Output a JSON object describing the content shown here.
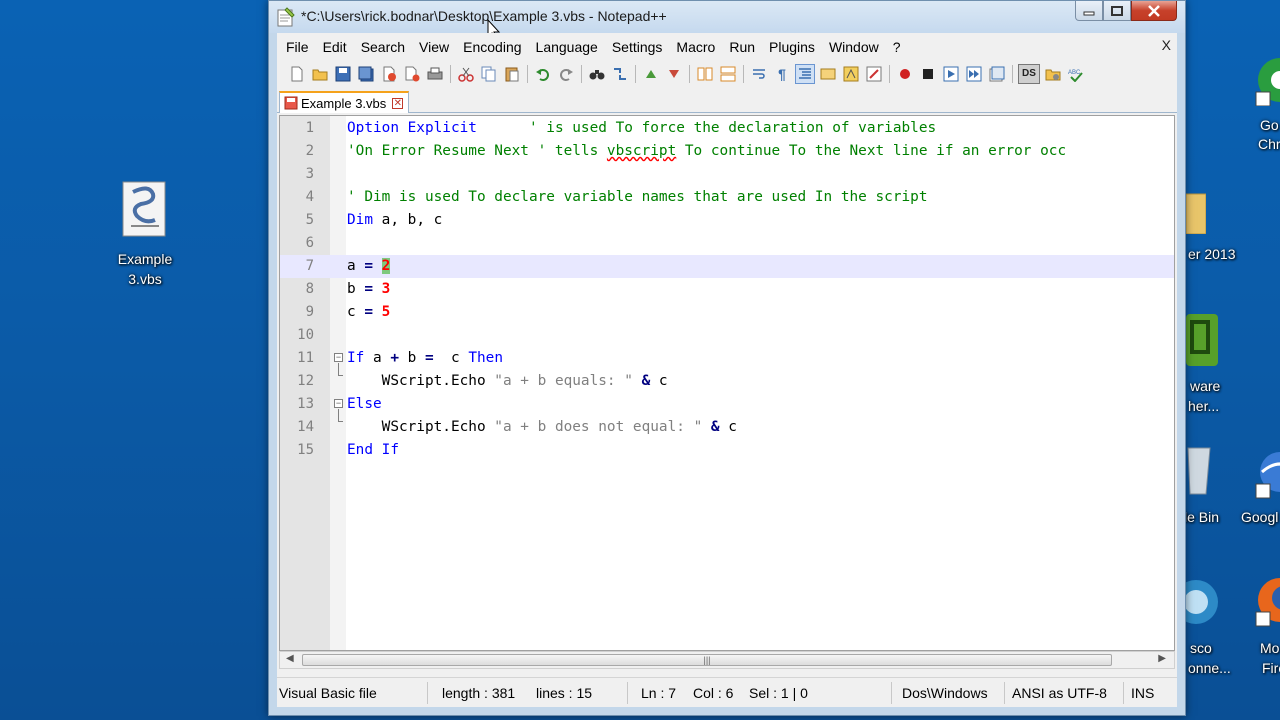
{
  "window": {
    "title": "*C:\\Users\\rick.bodnar\\Desktop\\Example 3.vbs - Notepad++"
  },
  "menu": [
    "File",
    "Edit",
    "Search",
    "View",
    "Encoding",
    "Language",
    "Settings",
    "Macro",
    "Run",
    "Plugins",
    "Window",
    "?"
  ],
  "menu_close": "X",
  "tab": {
    "label": "Example 3.vbs"
  },
  "desktop": {
    "left_icon": {
      "label_line1": "Example",
      "label_line2": "3.vbs"
    },
    "right_labels": [
      "Go",
      "Chr",
      "er 2013",
      "ware",
      "her...",
      "le Bin",
      "Googl",
      "sco",
      "onne...",
      "Mo",
      "Fire"
    ]
  },
  "editor": {
    "current_line": 7,
    "lines": [
      {
        "n": "1",
        "parts": [
          [
            "kw",
            "Option Explicit"
          ],
          [
            "",
            "      "
          ],
          [
            "cm",
            "' is used To force the declaration of variables"
          ]
        ]
      },
      {
        "n": "2",
        "parts": [
          [
            "cm",
            "'On Error Resume Next ' tells "
          ],
          [
            "cm spell",
            "vbscript"
          ],
          [
            "cm",
            " To continue To the Next line if an error occ"
          ]
        ]
      },
      {
        "n": "3",
        "parts": []
      },
      {
        "n": "4",
        "parts": [
          [
            "cm",
            "' Dim is used To declare variable names that are used In the script"
          ]
        ]
      },
      {
        "n": "5",
        "parts": [
          [
            "kw",
            "Dim"
          ],
          [
            "",
            " a, b, c"
          ]
        ]
      },
      {
        "n": "6",
        "parts": []
      },
      {
        "n": "7",
        "parts": [
          [
            "",
            "a "
          ],
          [
            "op",
            "="
          ],
          [
            "",
            " "
          ],
          [
            "num sel",
            "2"
          ]
        ]
      },
      {
        "n": "8",
        "parts": [
          [
            "",
            "b "
          ],
          [
            "op",
            "="
          ],
          [
            "",
            " "
          ],
          [
            "num",
            "3"
          ]
        ]
      },
      {
        "n": "9",
        "parts": [
          [
            "",
            "c "
          ],
          [
            "op",
            "="
          ],
          [
            "",
            " "
          ],
          [
            "num",
            "5"
          ]
        ]
      },
      {
        "n": "10",
        "parts": []
      },
      {
        "n": "11",
        "parts": [
          [
            "kw",
            "If"
          ],
          [
            "",
            " a "
          ],
          [
            "op",
            "+"
          ],
          [
            "",
            " b "
          ],
          [
            "op",
            "="
          ],
          [
            "",
            "  c "
          ],
          [
            "kw",
            "Then"
          ]
        ]
      },
      {
        "n": "12",
        "parts": [
          [
            "",
            "    WScript.Echo "
          ],
          [
            "str",
            "\"a + b equals: \""
          ],
          [
            "",
            " "
          ],
          [
            "op",
            "&"
          ],
          [
            "",
            " c"
          ]
        ]
      },
      {
        "n": "13",
        "parts": [
          [
            "kw",
            "Else"
          ]
        ]
      },
      {
        "n": "14",
        "parts": [
          [
            "",
            "    WScript.Echo "
          ],
          [
            "str",
            "\"a + b does not equal: \""
          ],
          [
            "",
            " "
          ],
          [
            "op",
            "&"
          ],
          [
            "",
            " c"
          ]
        ]
      },
      {
        "n": "15",
        "parts": [
          [
            "kw",
            "End If"
          ]
        ]
      }
    ]
  },
  "status": {
    "lang": "Visual Basic file",
    "length": "length : 381",
    "lines": "lines : 15",
    "ln": "Ln : 7",
    "col": "Col : 6",
    "sel": "Sel : 1 | 0",
    "eol": "Dos\\Windows",
    "encoding": "ANSI as UTF-8",
    "mode": "INS"
  },
  "scroll_thumb_glyph": "|||"
}
